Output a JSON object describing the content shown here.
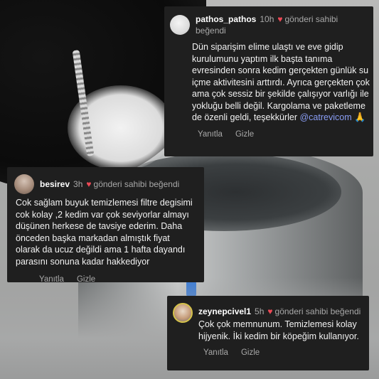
{
  "comments": [
    {
      "username": "pathos_pathos",
      "time": "10h",
      "liked_text": "gönderi sahibi beğendi",
      "text": "Dün siparişim elime ulaştı ve eve gidip kurulumunu yaptım ilk başta tanıma evresinden sonra kedim gerçekten günlük su içme aktivitesini arttırdı. Ayrıca gerçekten çok ama çok sessiz bir şekilde çalışıyor varlığı ile yokluğu belli değil. Kargolama ve paketleme de özenli geldi, teşekkürler",
      "mention": "@catrevicom",
      "emoji": "🙏",
      "reply_label": "Yanıtla",
      "hide_label": "Gizle"
    },
    {
      "username": "besirev",
      "time": "3h",
      "liked_text": "gönderi sahibi beğendi",
      "text": "Cok sağlam buyuk temizlemesi filtre degisimi cok kolay ,2 kedim var çok seviyorlar almayı düşünen herkese de tavsiye ederim. Daha önceden başka markadan almıştık fiyat olarak da ucuz değildi ama 1 hafta dayandı parasını sonuna kadar hakkediyor",
      "reply_label": "Yanıtla",
      "hide_label": "Gizle"
    },
    {
      "username": "zeynepcivel1",
      "time": "5h",
      "liked_text": "gönderi sahibi beğendi",
      "text": "Çok çok memnunum. Temizlemesi kolay hijyenik. İki kedim bir köpeğim kullanıyor.",
      "reply_label": "Yanıtla",
      "hide_label": "Gizle"
    }
  ],
  "colors": {
    "card_bg": "#1f1f1f",
    "heart": "#ed4956",
    "mention": "#8a9ef5",
    "meta_text": "#a8a8a8"
  },
  "icons": [
    "heart-icon",
    "avatar"
  ]
}
